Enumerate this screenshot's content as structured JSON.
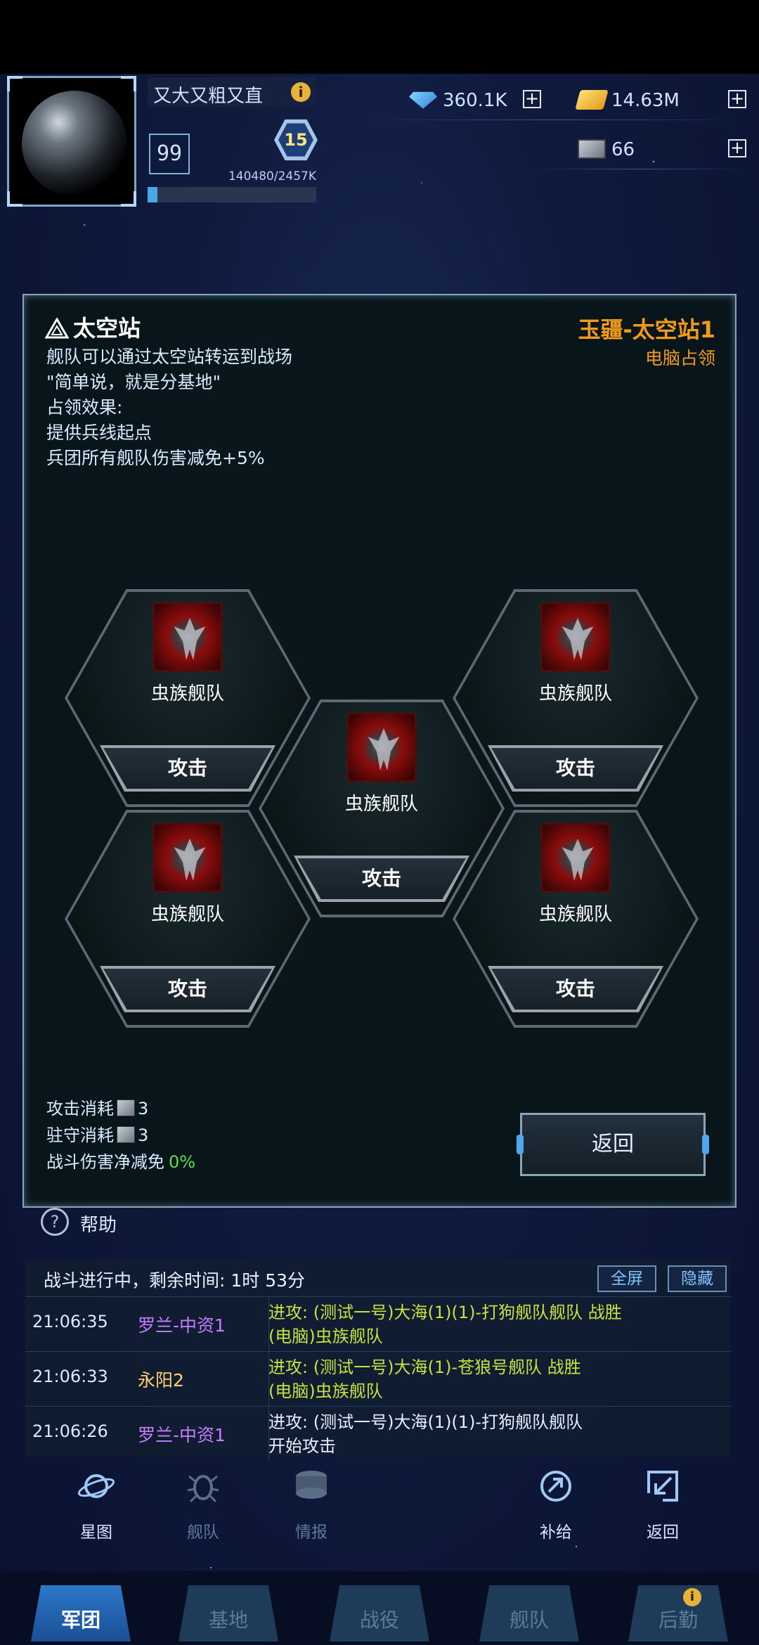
{
  "player": {
    "name": "又大又粗又直",
    "level": "99",
    "rank": "15",
    "exp_text": "140480/2457K",
    "exp_fraction": 0.057
  },
  "resources": {
    "diamonds": "360.1K",
    "gold": "14.63M",
    "crates": "66"
  },
  "panel": {
    "title": "太空站",
    "description": [
      "舰队可以通过太空站转运到战场",
      "\"简单说，就是分基地\"",
      "占领效果:",
      "提供兵线起点",
      "兵团所有舰队伤害减免+5%"
    ],
    "location_name": "玉疆-太空站1",
    "owner": "电脑占领",
    "fleets": [
      {
        "name": "虫族舰队",
        "button": "攻击"
      },
      {
        "name": "虫族舰队",
        "button": "攻击"
      },
      {
        "name": "虫族舰队",
        "button": "攻击"
      },
      {
        "name": "虫族舰队",
        "button": "攻击"
      },
      {
        "name": "虫族舰队",
        "button": "攻击"
      }
    ],
    "attack_cost_label": "攻击消耗",
    "attack_cost_value": "3",
    "garrison_cost_label": "驻守消耗",
    "garrison_cost_value": "3",
    "damage_reduction_label": "战斗伤害净减免",
    "damage_reduction_value": "0%",
    "back_button": "返回"
  },
  "help": {
    "label": "帮助"
  },
  "battle_log": {
    "status": "战斗进行中，剩余时间: 1时 53分",
    "fullscreen_button": "全屏",
    "hide_button": "隐藏",
    "entries": [
      {
        "time": "21:06:35",
        "who": "罗兰-中资1",
        "who_color": "#c77dff",
        "line1": "进攻: (测试一号)大海(1)(1)-打狗舰队舰队 战胜",
        "line2": "(电脑)虫族舰队",
        "color": "#c6e23e"
      },
      {
        "time": "21:06:33",
        "who": "永阳2",
        "who_color": "#ffd36a",
        "line1": "进攻: (测试一号)大海(1)-苍狼号舰队 战胜",
        "line2": "(电脑)虫族舰队",
        "color": "#c6e23e"
      },
      {
        "time": "21:06:26",
        "who": "罗兰-中资1",
        "who_color": "#c77dff",
        "line1": "进攻: (测试一号)大海(1)(1)-打狗舰队舰队",
        "line2": "开始攻击",
        "color": "#e6efff"
      }
    ]
  },
  "actions": [
    {
      "label": "星图",
      "icon": "planet-icon",
      "enabled": true
    },
    {
      "label": "舰队",
      "icon": "bug-icon",
      "enabled": false
    },
    {
      "label": "情报",
      "icon": "stack-icon",
      "enabled": false
    },
    {
      "label": "补给",
      "icon": "supply-icon",
      "enabled": true
    },
    {
      "label": "返回",
      "icon": "return-icon",
      "enabled": true
    }
  ],
  "nav": {
    "tabs": [
      "军团",
      "基地",
      "战役",
      "舰队",
      "后勤"
    ],
    "active": "军团"
  },
  "colors": {
    "accent_orange": "#f29a1c",
    "log_green": "#c6e23e",
    "reduction_green": "#5be046"
  }
}
